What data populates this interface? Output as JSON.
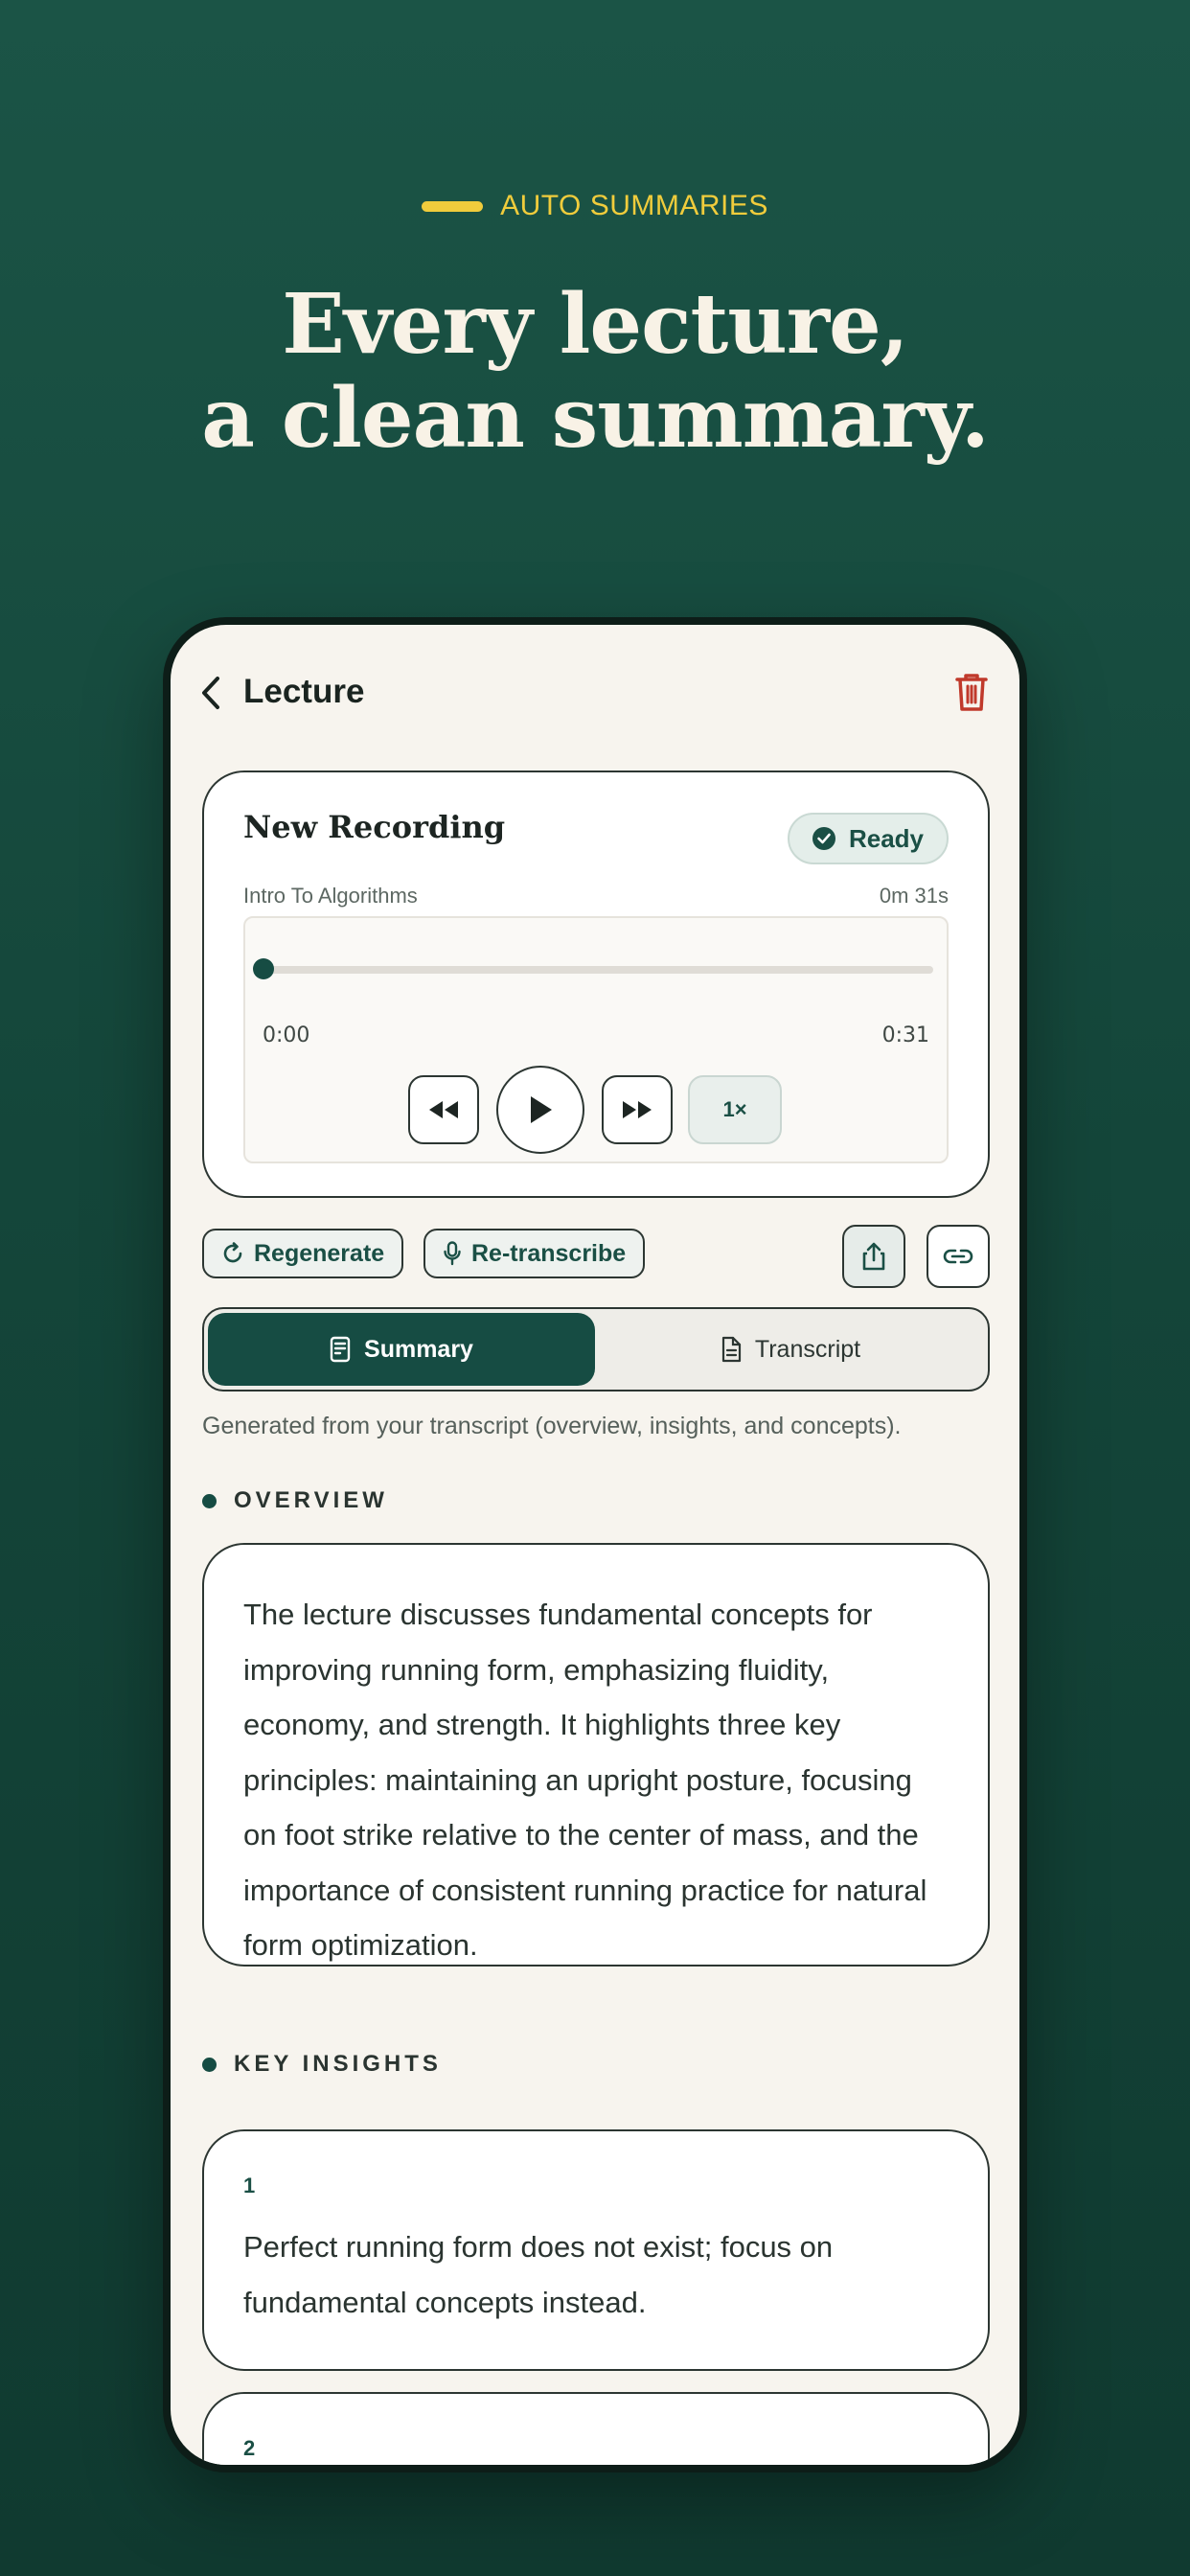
{
  "hero": {
    "eyebrow": "AUTO SUMMARIES",
    "headline_line1": "Every lecture,",
    "headline_line2": "a clean summary."
  },
  "appbar": {
    "title": "Lecture"
  },
  "recording": {
    "title": "New Recording",
    "status": "Ready",
    "subtitle": "Intro To Algorithms",
    "duration": "0m 31s",
    "current_time": "0:00",
    "total_time": "0:31",
    "progress": 0,
    "speed": "1×"
  },
  "actions": {
    "regenerate": "Regenerate",
    "retranscribe": "Re-transcribe"
  },
  "tabs": {
    "summary": "Summary",
    "transcript": "Transcript",
    "active": "Summary"
  },
  "summary": {
    "note": "Generated from your transcript (overview, insights, and concepts).",
    "overview_label": "OVERVIEW",
    "overview": "The lecture discusses fundamental concepts for improving running form, emphasizing fluidity, economy, and strength. It highlights three key principles: maintaining an upright posture, focusing on foot strike relative to the center of mass, and the importance of consistent running practice for natural form optimization.",
    "insights_label": "KEY INSIGHTS",
    "insights": [
      {
        "number": "1",
        "text": "Perfect running form does not exist; focus on fundamental concepts instead."
      },
      {
        "number": "2",
        "text": ""
      }
    ]
  },
  "colors": {
    "background": "#1b5446",
    "accent": "#f0cc3c",
    "primary": "#164c43",
    "danger": "#c0392b",
    "surface": "#f7f4ee"
  }
}
